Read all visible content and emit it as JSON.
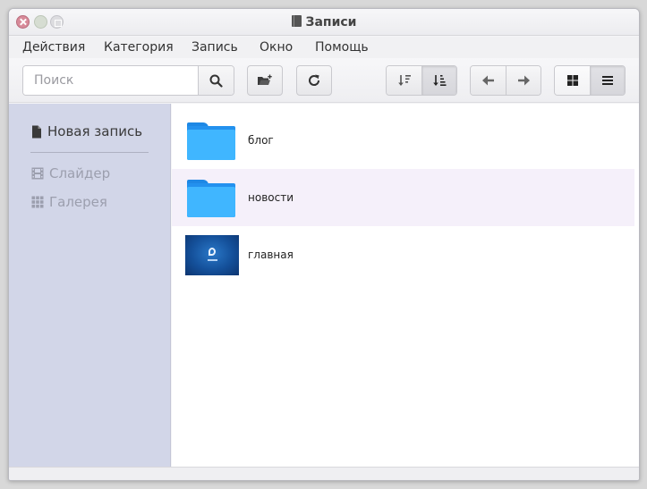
{
  "window": {
    "title": "Записи",
    "title_icon": "book-icon"
  },
  "menu": [
    "Действия",
    "Категория",
    "Запись",
    "Окно",
    "Помощь"
  ],
  "toolbar": {
    "search": {
      "placeholder": "Поиск",
      "value": ""
    },
    "search_icon": "magnifier-icon",
    "new_folder_icon": "folder-add-icon",
    "refresh_icon": "refresh-icon",
    "sort_icons": [
      "sort-desc-icon",
      "sort-asc-icon"
    ],
    "nav_icons": [
      "arrow-left-icon",
      "arrow-right-icon"
    ],
    "view_icons": [
      "grid-view-icon",
      "list-view-icon"
    ],
    "active_view": "list"
  },
  "sidebar": {
    "primary": {
      "label": "Новая запись",
      "icon": "document-icon"
    },
    "items": [
      {
        "label": "Слайдер",
        "icon": "film-icon",
        "enabled": false
      },
      {
        "label": "Галерея",
        "icon": "grid-icon",
        "enabled": false
      }
    ]
  },
  "entries": [
    {
      "name": "блог",
      "kind": "folder"
    },
    {
      "name": "новости",
      "kind": "folder",
      "highlighted": true
    },
    {
      "name": "главная",
      "kind": "image"
    }
  ],
  "colors": {
    "sidebar_bg": "#d2d6e8",
    "folder": "#40b6ff",
    "highlight_row": "#f5f0fa"
  }
}
